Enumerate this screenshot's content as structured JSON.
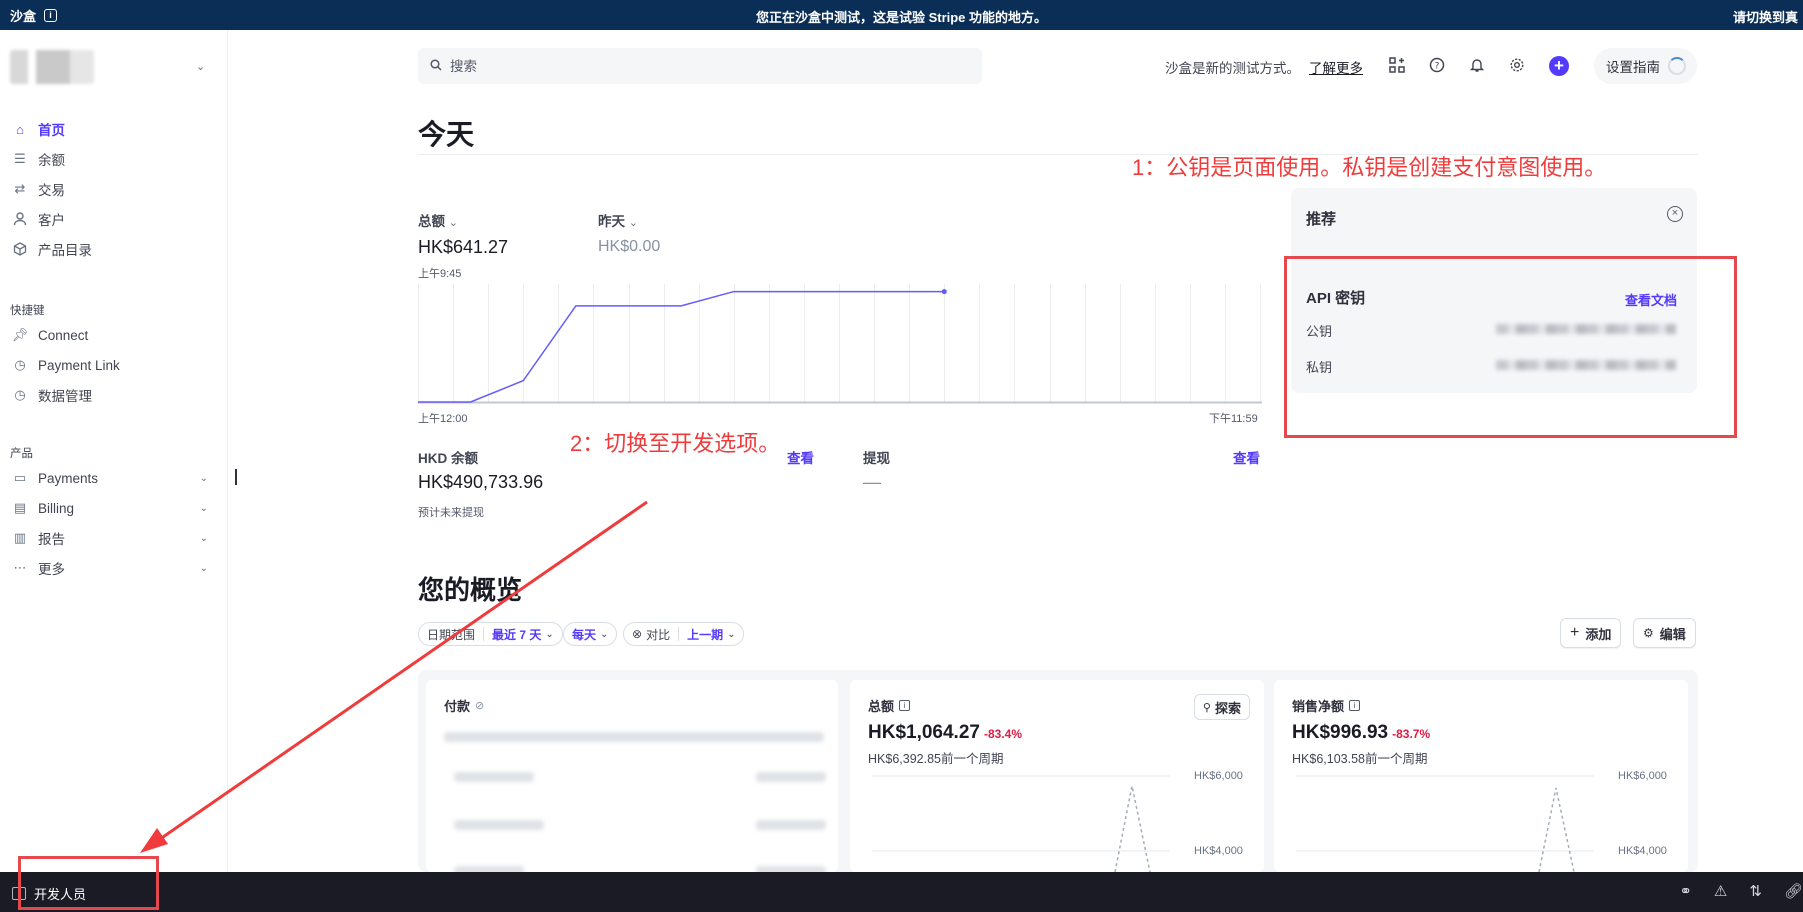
{
  "banner": {
    "sandbox_label": "沙盒",
    "message": "您正在沙盒中测试，这是试验 Stripe 功能的地方。",
    "right_text": "请切换到真"
  },
  "sidebar": {
    "nav": [
      {
        "label": "首页",
        "icon": "home-icon",
        "active": true
      },
      {
        "label": "余额",
        "icon": "balance-icon"
      },
      {
        "label": "交易",
        "icon": "transactions-icon"
      },
      {
        "label": "客户",
        "icon": "customer-icon"
      },
      {
        "label": "产品目录",
        "icon": "product-catalog-icon"
      }
    ],
    "shortcuts_label": "快捷键",
    "shortcuts": [
      {
        "label": "Connect",
        "icon": "pin-icon"
      },
      {
        "label": "Payment Link",
        "icon": "clock-icon"
      },
      {
        "label": "数据管理",
        "icon": "clock-icon"
      }
    ],
    "products_label": "产品",
    "products": [
      {
        "label": "Payments",
        "icon": "wallet-icon"
      },
      {
        "label": "Billing",
        "icon": "billing-icon"
      },
      {
        "label": "报告",
        "icon": "report-icon"
      },
      {
        "label": "更多",
        "icon": "more-icon"
      }
    ]
  },
  "bottombar": {
    "developer_label": "开发人员"
  },
  "header": {
    "search_placeholder": "搜索",
    "sandbox_note": "沙盒是新的测试方式。",
    "learn_more": "了解更多",
    "setup_guide": "设置指南"
  },
  "today": {
    "heading": "今天",
    "total_label": "总额",
    "total_value": "HK$641.27",
    "total_time": "上午9:45",
    "yesterday_label": "昨天",
    "yesterday_value": "HK$0.00",
    "axis_start": "上午12:00",
    "axis_end": "下午11:59",
    "hkd_balance_label": "HKD 余额",
    "hkd_balance_value": "HK$490,733.96",
    "hkd_balance_sub": "预计未来提现",
    "view_label": "查看",
    "payouts_label": "提现",
    "payouts_value": "—",
    "view_label_2": "查看"
  },
  "chart_data": {
    "type": "line",
    "title": "",
    "x": [
      "00:00",
      "01:00",
      "02:00",
      "03:00",
      "04:00",
      "05:00",
      "06:00",
      "07:00",
      "08:00",
      "09:00",
      "10:00"
    ],
    "series": [
      {
        "values": [
          0,
          0,
          60,
          270,
          270,
          270,
          310,
          310,
          310,
          310,
          310
        ]
      }
    ],
    "ylim": [
      0,
      320
    ],
    "x_labels": [
      "上午12:00",
      "下午11:59"
    ],
    "grid": true
  },
  "recommendations": {
    "title": "推荐",
    "api_title": "API 密钥",
    "view_docs": "查看文档",
    "publishable_label": "公钥",
    "secret_label": "私钥"
  },
  "annotations": {
    "note1": "1：公钥是页面使用。私钥是创建支付意图使用。",
    "note2": "2：切换至开发选项。"
  },
  "overview": {
    "heading": "您的概览",
    "date_range_label": "日期范围",
    "date_range_value": "最近 7 天",
    "interval": "每天",
    "compare_label": "对比",
    "compare_value": "上一期",
    "add_button": "添加",
    "edit_button": "编辑",
    "payments_title": "付款",
    "gross_title": "总额",
    "gross_value": "HK$1,064.27",
    "gross_delta": "-83.4%",
    "gross_prev": "HK$6,392.85前一个周期",
    "explore_button": "探索",
    "net_title": "销售净额",
    "net_value": "HK$996.93",
    "net_delta": "-83.7%",
    "net_prev": "HK$6,103.58前一个周期",
    "tick_6000": "HK$6,000",
    "tick_4000": "HK$4,000"
  },
  "colors": {
    "accent": "#533afd",
    "banner": "#0b2e57",
    "annotation_red": "#ef3b3b",
    "negative": "#df1b41"
  }
}
